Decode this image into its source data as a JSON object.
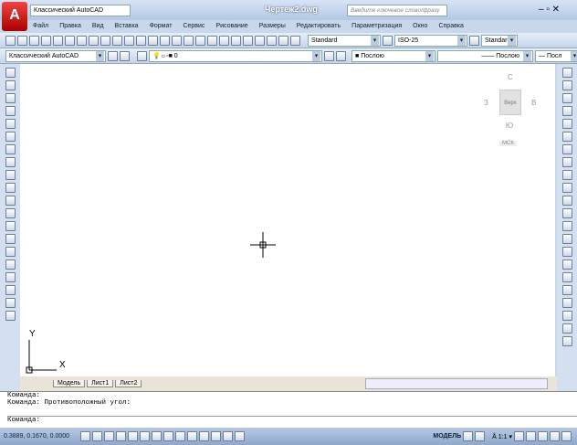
{
  "title": {
    "workspace": "Классический AutoCAD",
    "document": "Чертеж2.dwg",
    "search_placeholder": "Введите ключевое слово/фразу"
  },
  "menu": [
    "Файл",
    "Правка",
    "Вид",
    "Вставка",
    "Формат",
    "Сервис",
    "Рисование",
    "Размеры",
    "Редактировать",
    "Параметризация",
    "Окно",
    "Справка"
  ],
  "toolbar1": {
    "text_style": "Standard",
    "dim_style": "ISO-25",
    "table_style": "Standard"
  },
  "toolbar2": {
    "workspace": "Классический AutoCAD",
    "layer": "0",
    "color": "Послою",
    "linetype": "Послою",
    "lineweight": "Посл"
  },
  "viewcube": {
    "north": "С",
    "south": "Ю",
    "west": "З",
    "east": "В",
    "face": "Верх",
    "ucs": "МСК"
  },
  "ucs": {
    "x": "X",
    "y": "Y"
  },
  "tabs": [
    "Модель",
    "Лист1",
    "Лист2"
  ],
  "command": {
    "lines": [
      "Команда:",
      "Команда: Противоположный угол:"
    ],
    "prompt": "Команда:"
  },
  "status": {
    "coords": "0.3889, 0.1670, 0.0000",
    "model": "МОДЕЛЬ",
    "scale": "1:1"
  }
}
